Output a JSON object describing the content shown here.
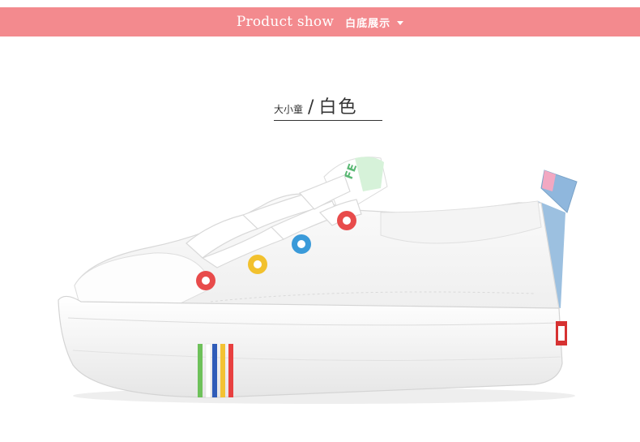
{
  "header": {
    "title_en": "Product show",
    "title_cn": "白底展示",
    "background": "#f38a8e"
  },
  "product": {
    "size_label": "大小童",
    "separator": "/",
    "color_label": "白色"
  },
  "icons": [
    "dropdown-arrow-icon"
  ]
}
